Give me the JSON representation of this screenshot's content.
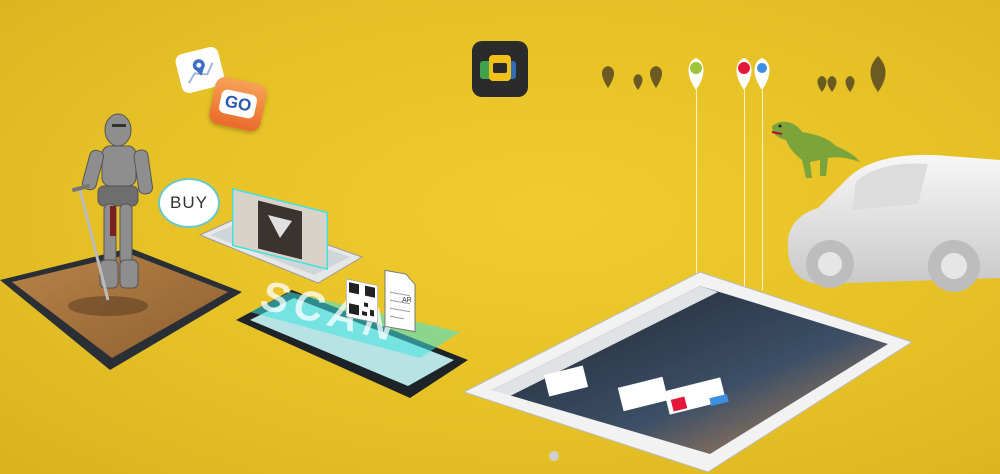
{
  "scene": {
    "buy_label": "BUY",
    "go_label": "GO",
    "scan_label": "SCAN",
    "ar_label": "AR"
  },
  "icons": [
    "app-logo-icon",
    "map-pin-icon",
    "go-app-icon",
    "qr-code-icon",
    "document-icon",
    "location-pin-icon"
  ],
  "colors": {
    "background": "#e8c428",
    "accent_cyan": "#3fe3de",
    "pin_dark": "#6b5a22",
    "pin_green": "#9fc43a",
    "pin_red": "#e3183a",
    "pin_blue": "#3d8fe0"
  }
}
